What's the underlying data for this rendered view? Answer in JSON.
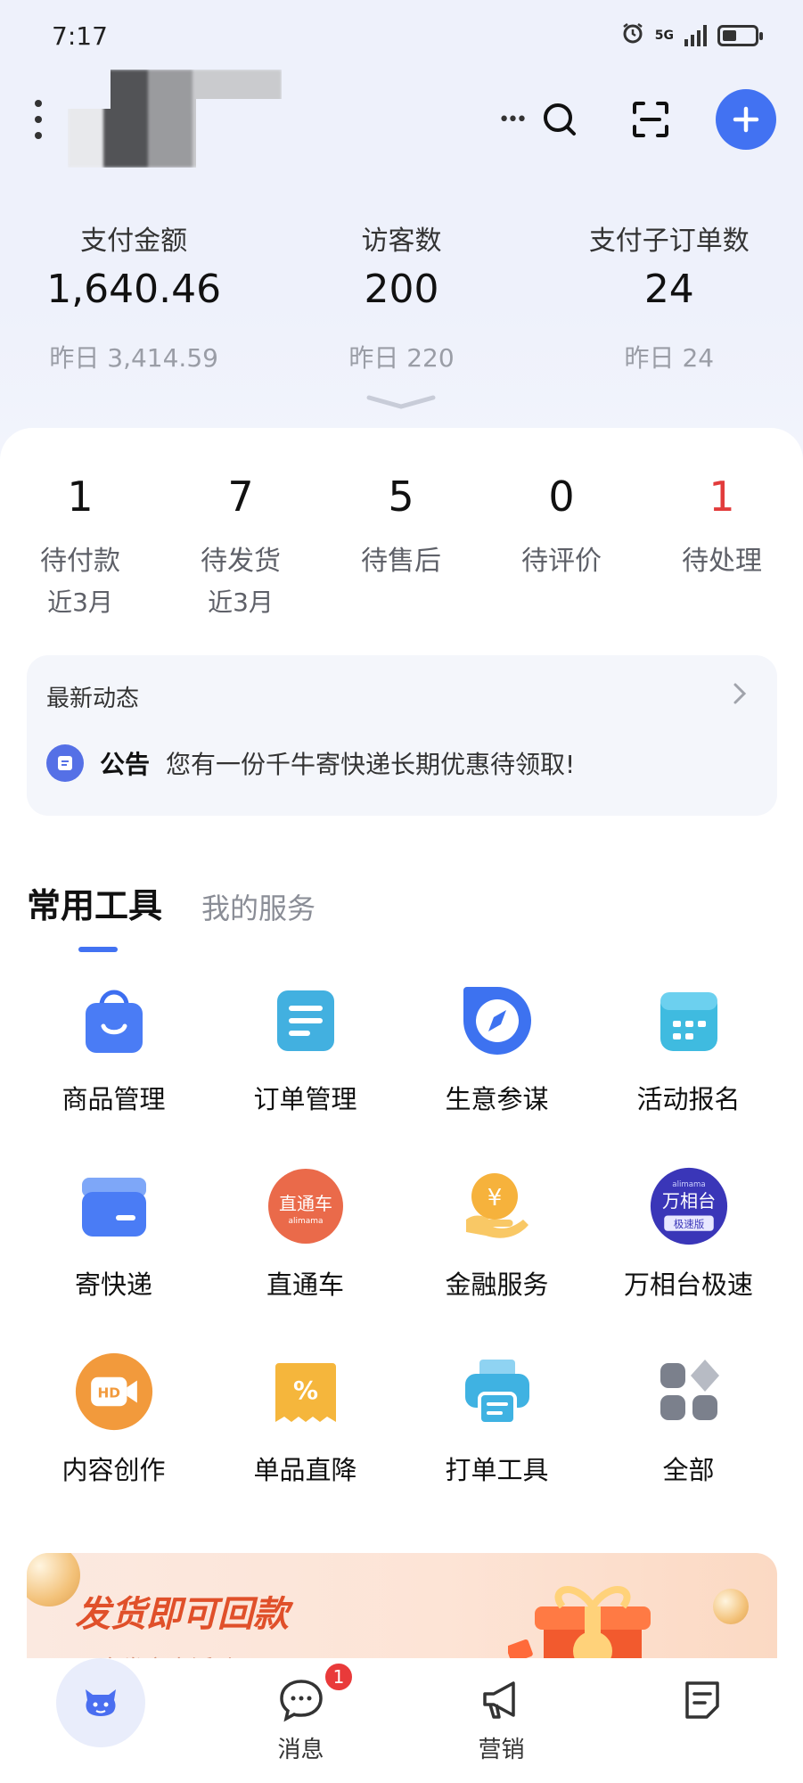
{
  "status_bar": {
    "time": "7:17",
    "network": "5G",
    "battery_level": 0.45
  },
  "header": {
    "shop_name": ""
  },
  "stats": [
    {
      "label": "支付金额",
      "value": "1,640.46",
      "yesterday": "昨日 3,414.59"
    },
    {
      "label": "访客数",
      "value": "200",
      "yesterday": "昨日 220"
    },
    {
      "label": "支付子订单数",
      "value": "24",
      "yesterday": "昨日 24"
    }
  ],
  "orders": [
    {
      "count": "1",
      "label": "待付款",
      "sub": "近3月"
    },
    {
      "count": "7",
      "label": "待发货",
      "sub": "近3月"
    },
    {
      "count": "5",
      "label": "待售后",
      "sub": ""
    },
    {
      "count": "0",
      "label": "待评价",
      "sub": ""
    },
    {
      "count": "1",
      "label": "待处理",
      "sub": ""
    }
  ],
  "news": {
    "title": "最新动态",
    "tag": "公告",
    "text": "您有一份千牛寄快递长期优惠待领取!"
  },
  "tabs": {
    "active": "常用工具",
    "other": "我的服务"
  },
  "tools": [
    {
      "label": "商品管理",
      "icon": "shopping-bag-icon"
    },
    {
      "label": "订单管理",
      "icon": "order-list-icon"
    },
    {
      "label": "生意参谋",
      "icon": "compass-icon"
    },
    {
      "label": "活动报名",
      "icon": "calendar-icon"
    },
    {
      "label": "寄快递",
      "icon": "box-icon"
    },
    {
      "label": "直通车",
      "icon": "zhitongche-logo-icon",
      "badge_text": "直通车",
      "badge_sub": "alimama"
    },
    {
      "label": "金融服务",
      "icon": "coin-hand-icon",
      "symbol": "¥"
    },
    {
      "label": "万相台极速",
      "icon": "wanxiangtai-logo-icon",
      "badge_text": "万相台",
      "badge_top": "alimama",
      "badge_sub": "极速版"
    },
    {
      "label": "内容创作",
      "icon": "hd-video-icon",
      "symbol": "HD"
    },
    {
      "label": "单品直降",
      "icon": "coupon-icon",
      "symbol": "%"
    },
    {
      "label": "打单工具",
      "icon": "printer-icon"
    },
    {
      "label": "全部",
      "icon": "all-apps-icon"
    }
  ],
  "banner": {
    "title": "发货即可回款",
    "subtitle": "现金券立省活动"
  },
  "bottom_nav": [
    {
      "label": "",
      "icon": "home-cow-icon"
    },
    {
      "label": "消息",
      "icon": "message-icon",
      "badge": "1"
    },
    {
      "label": "营销",
      "icon": "megaphone-icon"
    },
    {
      "label": "",
      "icon": "document-icon"
    }
  ],
  "colors": {
    "accent": "#4272f2",
    "alert": "#e23b3b",
    "banner_title": "#e0502a"
  }
}
